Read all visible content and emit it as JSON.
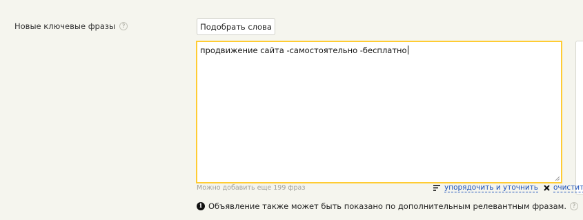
{
  "form": {
    "label": "Новые ключевые фразы",
    "pick_button_label": "Подобрать слова",
    "textarea_value": "продвижение сайта -самостоятельно -бесплатно",
    "hint": "Можно добавить еще 199 фраз",
    "sort_action_label": "упорядочить и уточнить",
    "clear_action_label": "очистить",
    "info_text": "Объявление также может быть показано по дополнительным релевантным фразам."
  },
  "icons": {
    "label_help": "help-icon",
    "sort": "sort-icon",
    "clear": "close-icon",
    "info": "info-icon",
    "info_help": "help-icon"
  },
  "colors": {
    "background": "#f5f5ee",
    "focus_border": "#ffcc33",
    "link": "#1a4fb8"
  }
}
